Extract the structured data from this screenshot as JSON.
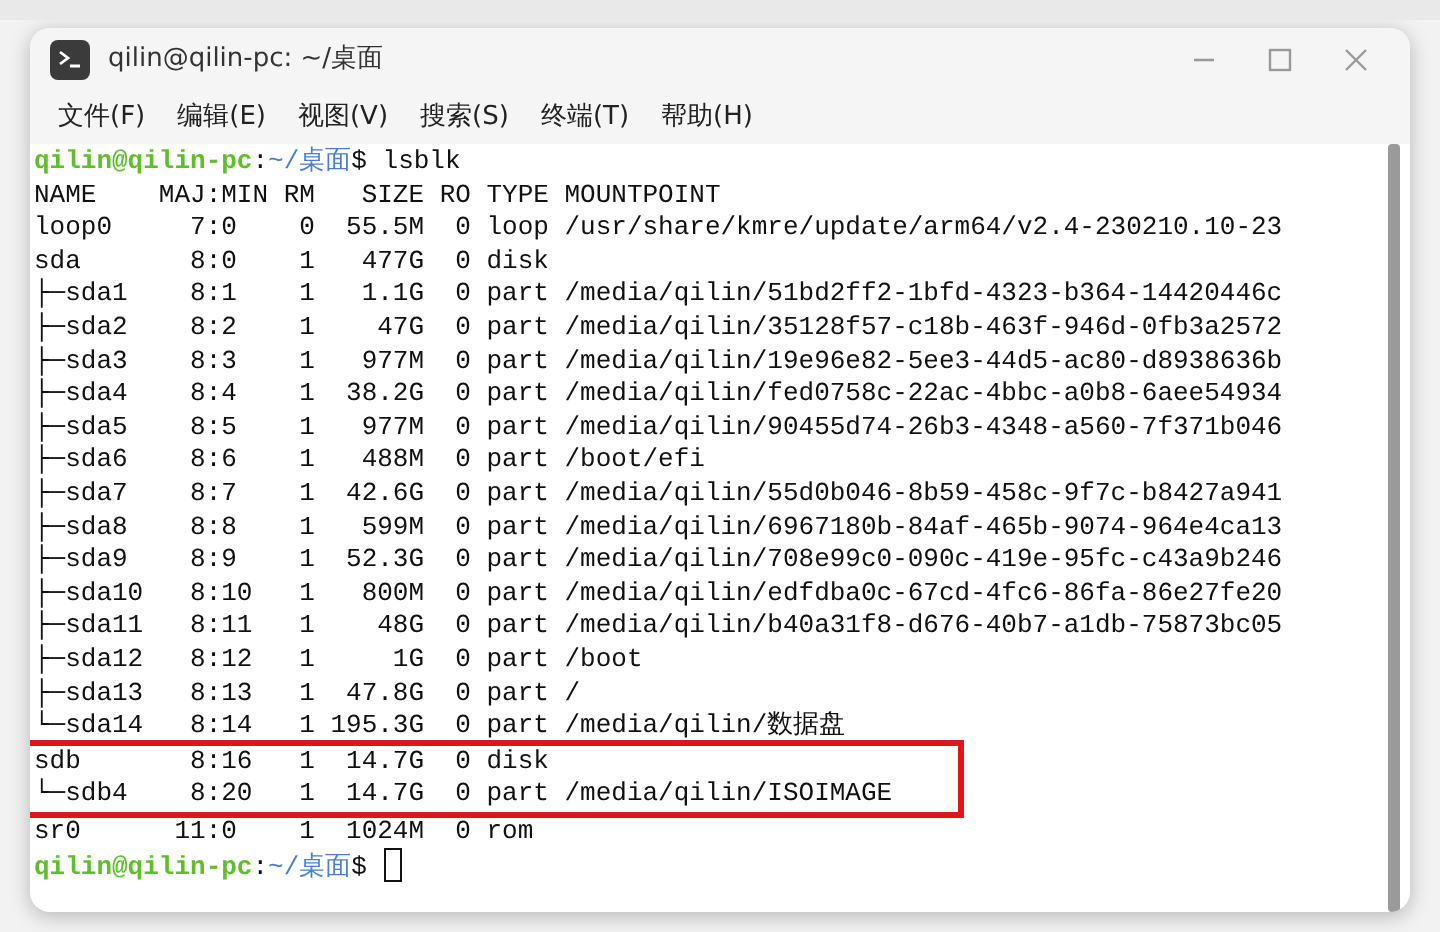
{
  "window": {
    "title": "qilin@qilin-pc: ~/桌面"
  },
  "menu": [
    "文件(F)",
    "编辑(E)",
    "视图(V)",
    "搜索(S)",
    "终端(T)",
    "帮助(H)"
  ],
  "terminal": {
    "lines": [
      {
        "kind": "prompt",
        "user": "qilin@qilin-pc",
        "separator": ":",
        "path": "~/桌面",
        "symbol": "$",
        "command": "lsblk"
      },
      {
        "kind": "output",
        "text": "NAME    MAJ:MIN RM   SIZE RO TYPE MOUNTPOINT",
        "highlighted": false
      },
      {
        "kind": "output",
        "text": "loop0     7:0    0  55.5M  0 loop /usr/share/kmre/update/arm64/v2.4-230210.10-23",
        "highlighted": false
      },
      {
        "kind": "output",
        "text": "sda       8:0    1   477G  0 disk",
        "highlighted": false
      },
      {
        "kind": "output",
        "text": "├─sda1    8:1    1   1.1G  0 part /media/qilin/51bd2ff2-1bfd-4323-b364-14420446c",
        "highlighted": false
      },
      {
        "kind": "output",
        "text": "├─sda2    8:2    1    47G  0 part /media/qilin/35128f57-c18b-463f-946d-0fb3a2572",
        "highlighted": false
      },
      {
        "kind": "output",
        "text": "├─sda3    8:3    1   977M  0 part /media/qilin/19e96e82-5ee3-44d5-ac80-d8938636b",
        "highlighted": false
      },
      {
        "kind": "output",
        "text": "├─sda4    8:4    1  38.2G  0 part /media/qilin/fed0758c-22ac-4bbc-a0b8-6aee54934",
        "highlighted": false
      },
      {
        "kind": "output",
        "text": "├─sda5    8:5    1   977M  0 part /media/qilin/90455d74-26b3-4348-a560-7f371b046",
        "highlighted": false
      },
      {
        "kind": "output",
        "text": "├─sda6    8:6    1   488M  0 part /boot/efi",
        "highlighted": false
      },
      {
        "kind": "output",
        "text": "├─sda7    8:7    1  42.6G  0 part /media/qilin/55d0b046-8b59-458c-9f7c-b8427a941",
        "highlighted": false
      },
      {
        "kind": "output",
        "text": "├─sda8    8:8    1   599M  0 part /media/qilin/6967180b-84af-465b-9074-964e4ca13",
        "highlighted": false
      },
      {
        "kind": "output",
        "text": "├─sda9    8:9    1  52.3G  0 part /media/qilin/708e99c0-090c-419e-95fc-c43a9b246",
        "highlighted": false
      },
      {
        "kind": "output",
        "text": "├─sda10   8:10   1   800M  0 part /media/qilin/edfdba0c-67cd-4fc6-86fa-86e27fe20",
        "highlighted": false
      },
      {
        "kind": "output",
        "text": "├─sda11   8:11   1    48G  0 part /media/qilin/b40a31f8-d676-40b7-a1db-75873bc05",
        "highlighted": false
      },
      {
        "kind": "output",
        "text": "├─sda12   8:12   1     1G  0 part /boot",
        "highlighted": false
      },
      {
        "kind": "output",
        "text": "├─sda13   8:13   1  47.8G  0 part /",
        "highlighted": false
      },
      {
        "kind": "output",
        "text": "└─sda14   8:14   1 195.3G  0 part /media/qilin/数据盘",
        "highlighted": false
      },
      {
        "kind": "output",
        "text": "sdb       8:16   1  14.7G  0 disk",
        "highlighted": true
      },
      {
        "kind": "output",
        "text": "└─sdb4    8:20   1  14.7G  0 part /media/qilin/ISOIMAGE",
        "highlighted": true
      },
      {
        "kind": "output",
        "text": "sr0      11:0    1  1024M  0 rom",
        "highlighted": false
      },
      {
        "kind": "prompt",
        "user": "qilin@qilin-pc",
        "separator": ":",
        "path": "~/桌面",
        "symbol": "$",
        "cursor": true
      }
    ]
  }
}
